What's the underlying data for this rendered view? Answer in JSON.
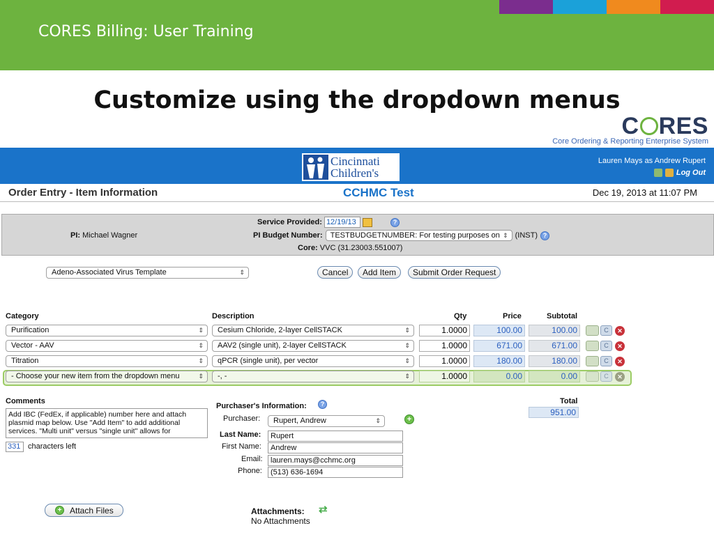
{
  "slide": {
    "title": "CORES Billing: User Training",
    "headline": "Customize using the dropdown menus",
    "stripe_colors": [
      "#7b2d8e",
      "#1ba1d9",
      "#f08a1e",
      "#d11c4f"
    ]
  },
  "logo": {
    "word_prefix": "C",
    "word_suffix": "RES",
    "tagline": "Core Ordering & Reporting Enterprise System"
  },
  "header": {
    "org_line1": "Cincinnati",
    "org_line2": "Children's",
    "user_text": "Lauren Mays as Andrew Rupert",
    "logout_label": "Log Out"
  },
  "page": {
    "section_title": "Order Entry - Item Information",
    "site_name": "CCHMC Test",
    "datetime": "Dec 19, 2013 at 11:07 PM"
  },
  "info": {
    "pi_label": "PI:",
    "pi_value": "Michael Wagner",
    "service_label": "Service Provided:",
    "service_date": "12/19/13",
    "budget_label": "PI Budget Number:",
    "budget_value": "TESTBUDGETNUMBER: For testing purposes on",
    "budget_suffix": "(INST)",
    "core_label": "Core:",
    "core_value": "VVC (31.23003.551007)"
  },
  "controls": {
    "template_select": "Adeno-Associated Virus Template",
    "cancel_label": "Cancel",
    "add_item_label": "Add Item",
    "submit_label": "Submit Order Request"
  },
  "table": {
    "headers": {
      "category": "Category",
      "description": "Description",
      "qty": "Qty",
      "price": "Price",
      "subtotal": "Subtotal"
    },
    "rows": [
      {
        "category": "Purification",
        "description": "Cesium Chloride, 2-layer CellSTACK",
        "qty": "1.0000",
        "price": "100.00",
        "subtotal": "100.00"
      },
      {
        "category": "Vector - AAV",
        "description": "AAV2 (single unit), 2-layer CellSTACK",
        "qty": "1.0000",
        "price": "671.00",
        "subtotal": "671.00"
      },
      {
        "category": "Titration",
        "description": "qPCR (single unit), per vector",
        "qty": "1.0000",
        "price": "180.00",
        "subtotal": "180.00"
      },
      {
        "category": "- Choose your new item from the dropdown menu",
        "description": "-, -",
        "qty": "1.0000",
        "price": "0.00",
        "subtotal": "0.00"
      }
    ],
    "row_button_label": "C"
  },
  "comments": {
    "label": "Comments",
    "text": "Add IBC (FedEx, if applicable) number here and attach plasmid map below. Use \"Add Item\" to add additional services. \"Multi unit\" versus \"single unit\" allows for",
    "chars_left_count": "331",
    "chars_left_label": "characters left"
  },
  "purchaser": {
    "heading": "Purchaser's Information:",
    "purchaser_label": "Purchaser:",
    "purchaser_value": "Rupert, Andrew",
    "last_name_label": "Last Name:",
    "last_name_value": "Rupert",
    "first_name_label": "First Name:",
    "first_name_value": "Andrew",
    "email_label": "Email:",
    "email_value": "lauren.mays@cchmc.org",
    "phone_label": "Phone:",
    "phone_value": "(513) 636-1694"
  },
  "total": {
    "label": "Total",
    "value": "951.00"
  },
  "attachments": {
    "attach_button": "Attach Files",
    "label": "Attachments:",
    "value": "No Attachments"
  }
}
